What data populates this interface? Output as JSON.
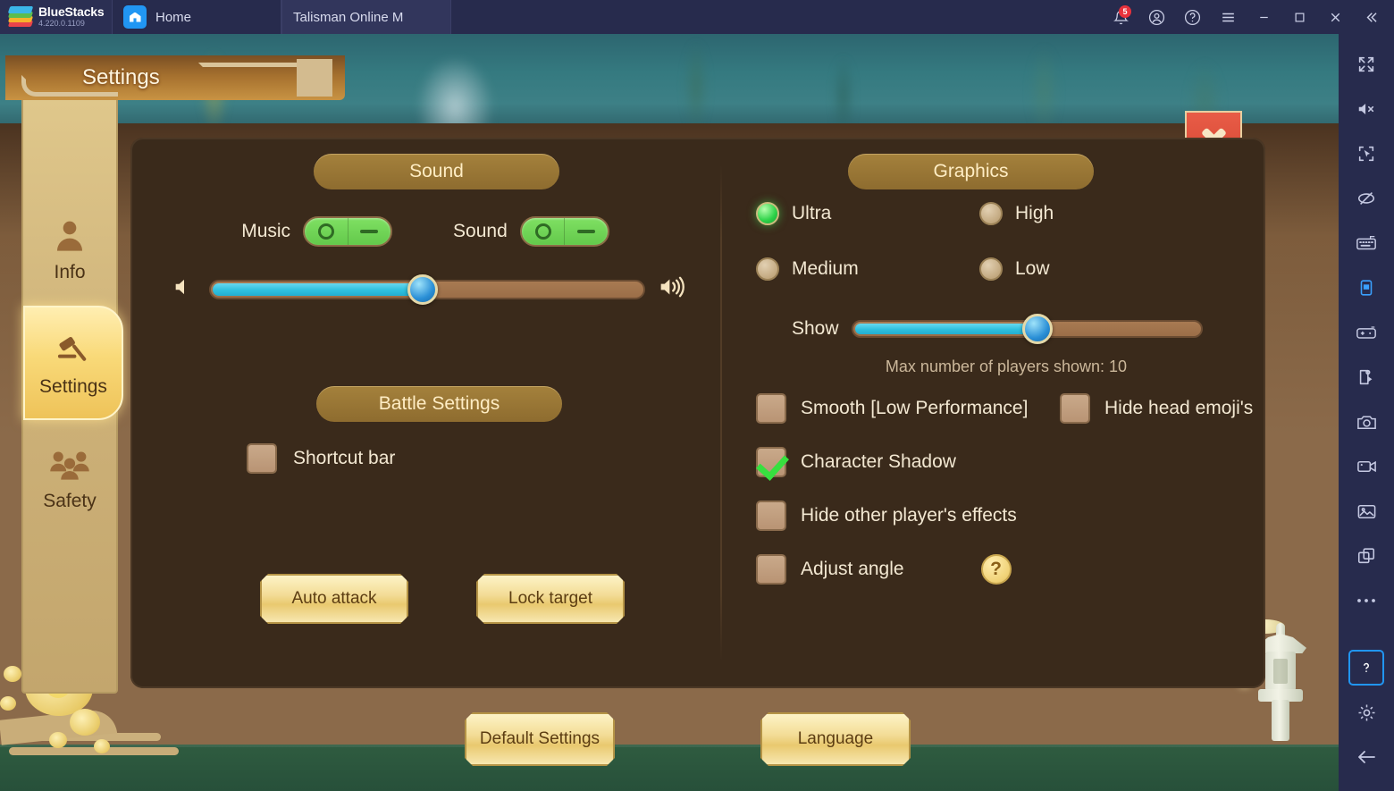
{
  "titlebar": {
    "brand": "BlueStacks",
    "version": "4.220.0.1109",
    "tabs": [
      {
        "label": "Home",
        "icon": "home-icon"
      },
      {
        "label": "Talisman Online M",
        "icon": "game-icon"
      }
    ],
    "notification_count": "5",
    "controls": [
      {
        "name": "notifications-icon"
      },
      {
        "name": "account-icon"
      },
      {
        "name": "help-icon"
      },
      {
        "name": "menu-icon"
      },
      {
        "name": "minimize-icon"
      },
      {
        "name": "maximize-icon"
      },
      {
        "name": "close-icon"
      },
      {
        "name": "collapse-icon"
      }
    ]
  },
  "right_toolbar": {
    "items": [
      "fullscreen-icon",
      "mute-icon",
      "cursor-target-icon",
      "eye-off-icon",
      "keyboard-icon",
      "rotate-device-icon",
      "gamepad-icon",
      "script-icon",
      "screenshot-icon",
      "record-video-icon",
      "media-gallery-icon",
      "multi-instance-icon",
      "more-icon",
      "help-icon",
      "settings-gear-icon",
      "back-arrow-icon"
    ]
  },
  "window": {
    "title": "Settings",
    "close_label": "✕"
  },
  "sidebar": {
    "items": [
      {
        "label": "Info",
        "icon": "person-icon",
        "active": false
      },
      {
        "label": "Settings",
        "icon": "gavel-icon",
        "active": true
      },
      {
        "label": "Safety",
        "icon": "people-icon",
        "active": false
      }
    ]
  },
  "sound": {
    "section_title": "Sound",
    "music_label": "Music",
    "music_on": true,
    "sound_label": "Sound",
    "sound_on": true,
    "volume_percent": 49,
    "volume_low_icon": "speaker-mute-icon",
    "volume_high_icon": "speaker-loud-icon"
  },
  "battle": {
    "section_title": "Battle Settings",
    "shortcut_bar_label": "Shortcut bar",
    "shortcut_bar_checked": false,
    "auto_attack_label": "Auto attack",
    "lock_target_label": "Lock target"
  },
  "graphics": {
    "section_title": "Graphics",
    "quality_options": [
      {
        "label": "Ultra",
        "selected": true
      },
      {
        "label": "High",
        "selected": false
      },
      {
        "label": "Medium",
        "selected": false
      },
      {
        "label": "Low",
        "selected": false
      }
    ],
    "show_label": "Show",
    "show_percent": 53,
    "max_players_text": "Max number of players shown: 10",
    "checkboxes": [
      {
        "label": "Smooth [Low Performance]",
        "checked": false
      },
      {
        "label": "Hide head emoji's",
        "checked": false
      },
      {
        "label": "Character Shadow",
        "checked": true
      },
      {
        "label": "Hide other player's effects",
        "checked": false
      },
      {
        "label": "Adjust angle",
        "checked": false
      }
    ],
    "help_badge": "?"
  },
  "footer": {
    "default_settings_label": "Default Settings",
    "language_label": "Language"
  },
  "colors": {
    "panel_bg": "#3a2a1b",
    "accent_gold": "#f3dc96",
    "slider_fill": "#2fc0de",
    "toggle_on": "#63c94b",
    "radio_selected": "#2fd34a",
    "close_red": "#d3432f",
    "titlebar_bg": "#272b4d"
  }
}
